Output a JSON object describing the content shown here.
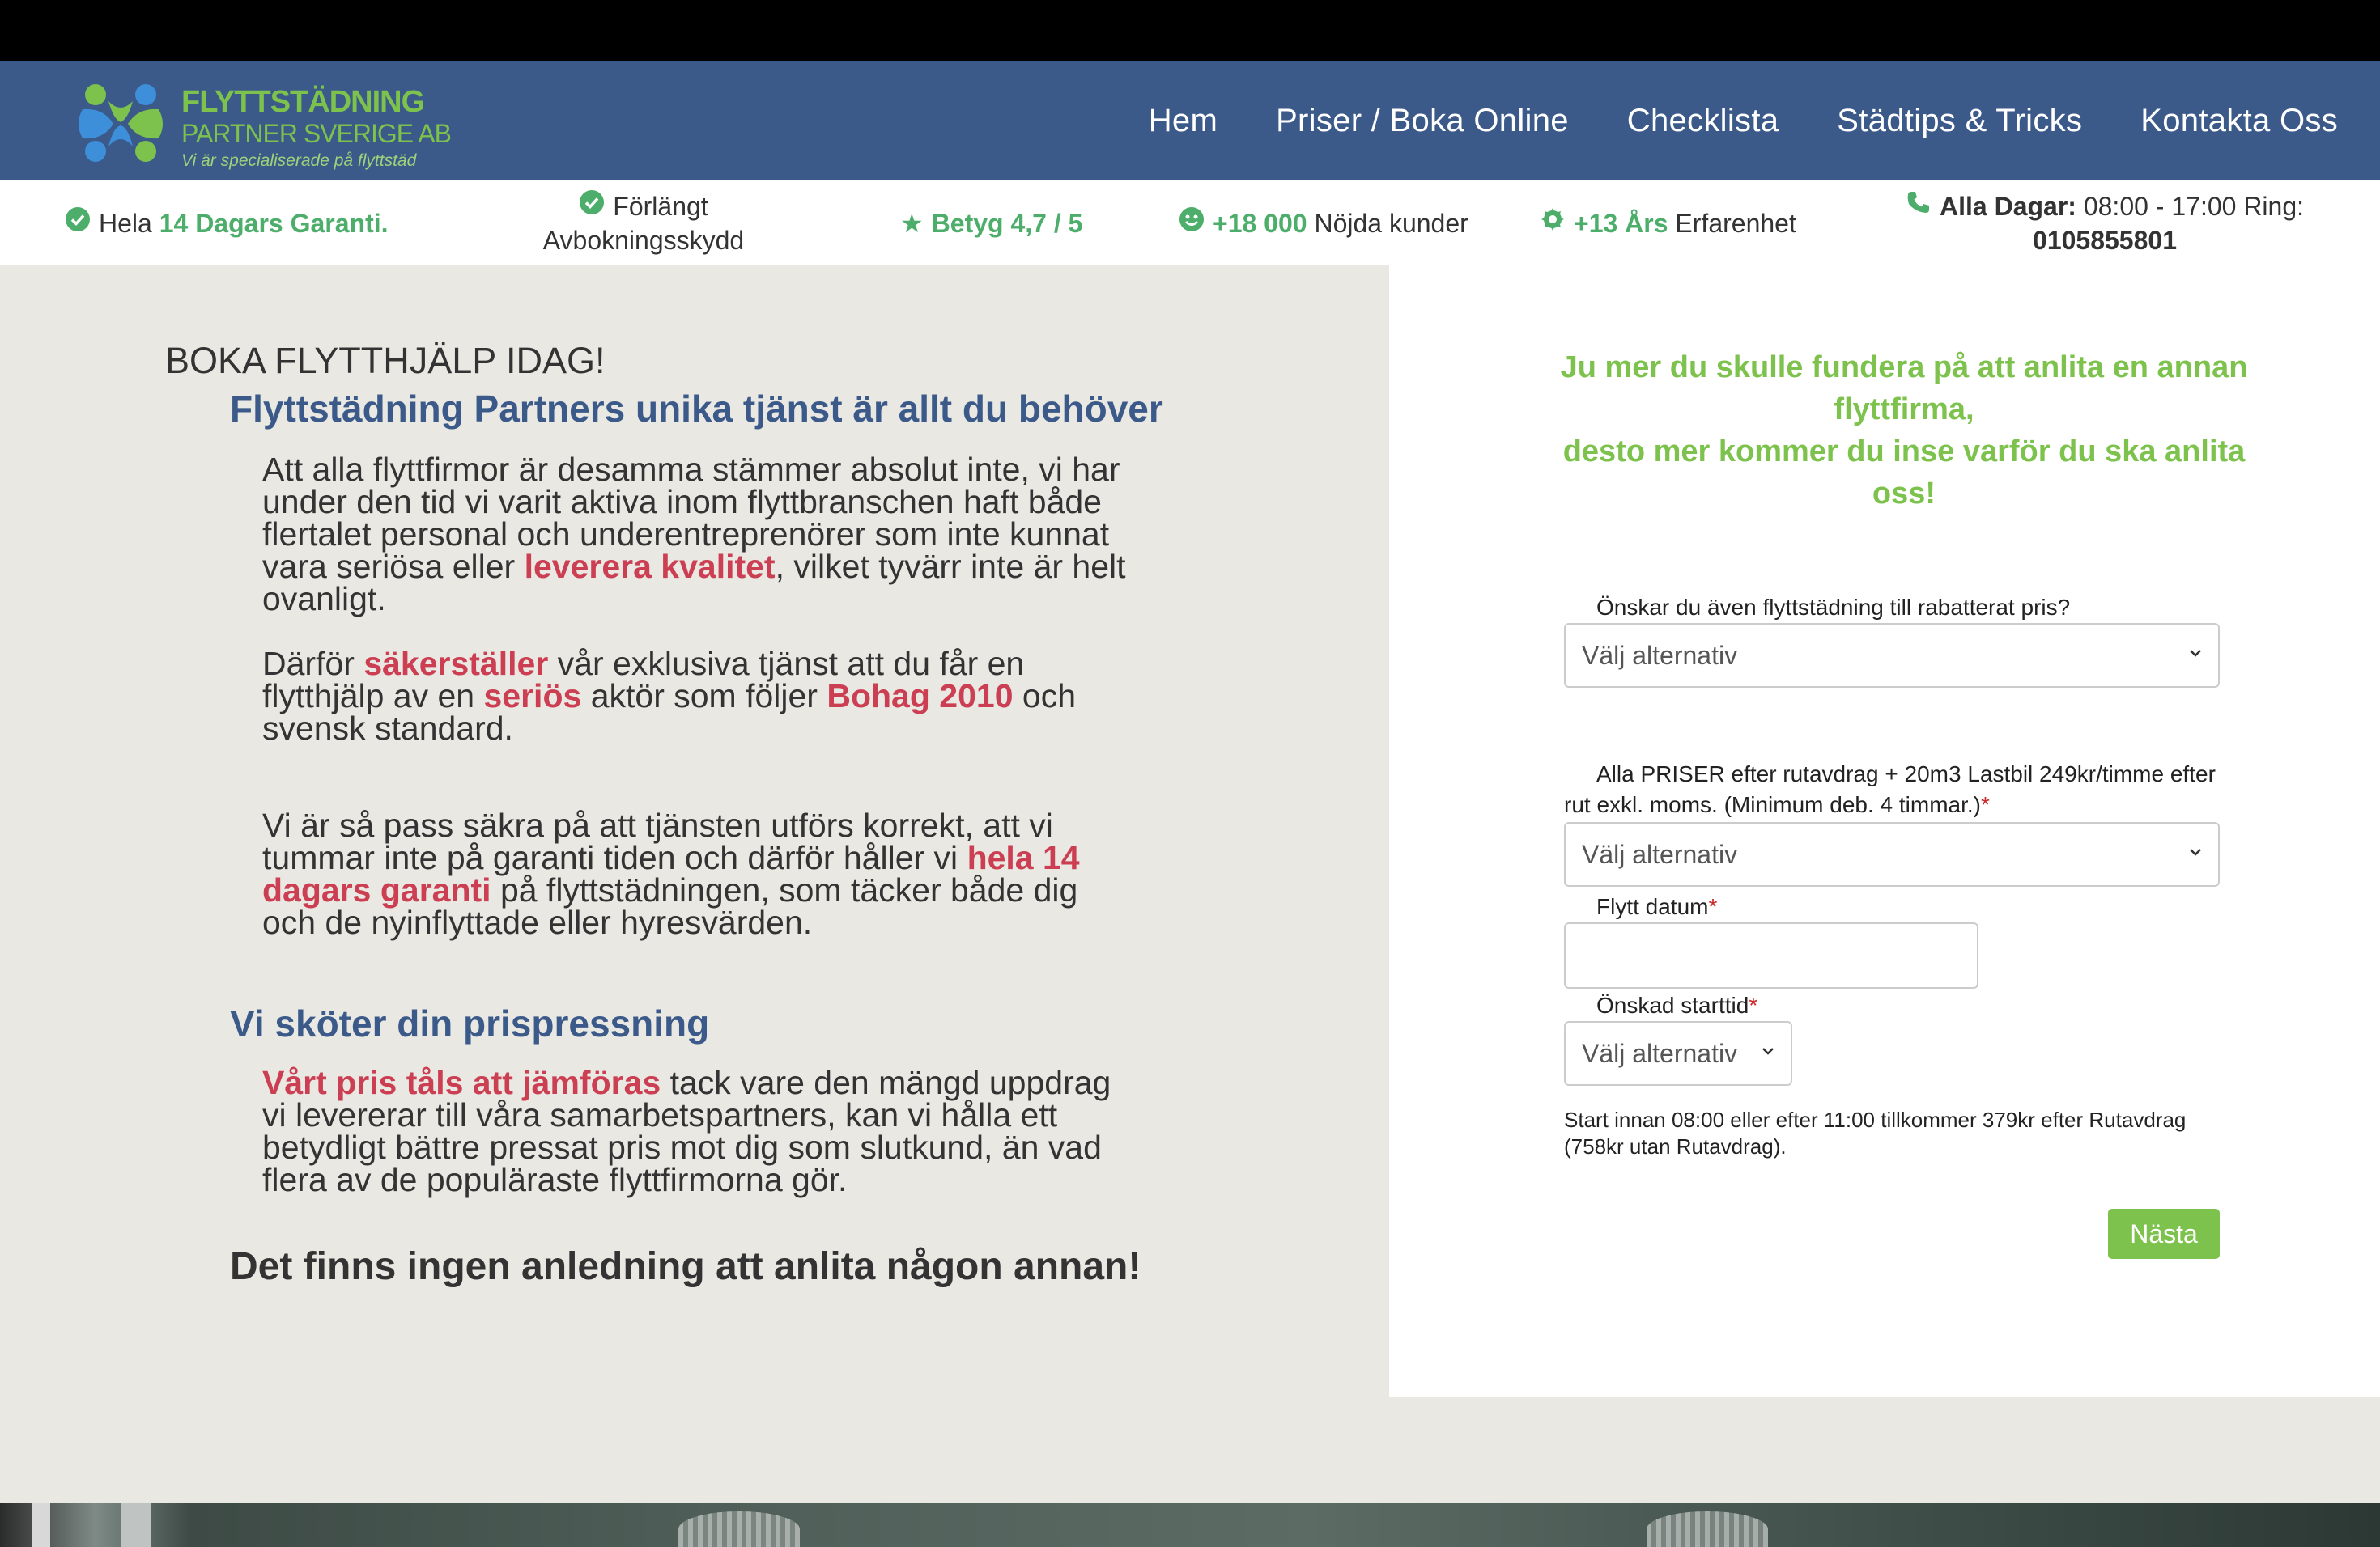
{
  "nav": {
    "logo": {
      "title": "FLYTTSTÄDNING",
      "subtitle": "PARTNER SVERIGE AB",
      "tagline": "Vi är specialiserade på flyttstäd"
    },
    "menu": [
      "Hem",
      "Priser / Boka Online",
      "Checklista",
      "Städtips & Tricks",
      "Kontakta Oss"
    ]
  },
  "usp": {
    "guarantee": {
      "icon": "check-circle-icon",
      "pre": "Hela",
      "strong": "14 Dagars Garanti."
    },
    "cancellation": {
      "icon": "check-circle-icon",
      "line1": "Förlängt",
      "line2": "Avbokningsskydd"
    },
    "rating": {
      "icon": "star-icon",
      "text": "Betyg 4,7 / 5"
    },
    "customers": {
      "icon": "smiley-icon",
      "strong": "+18 000",
      "post": "Nöjda kunder"
    },
    "experience": {
      "icon": "medal-icon",
      "strong": "+13 Års",
      "post": "Erfarenhet"
    },
    "contact": {
      "icon": "phone-icon",
      "label": "Alla Dagar:",
      "hours": "08:00 - 17:00 Ring:",
      "phone": "0105855801"
    }
  },
  "content": {
    "heading": "BOKA FLYTTHJÄLP IDAG!",
    "subheading": "Flyttstädning Partners unika tjänst är allt du behöver",
    "p1": {
      "a": "Att alla flyttfirmor är desamma stämmer absolut inte, vi har under den tid vi varit aktiva inom flyttbranschen haft både flertalet personal och underentreprenörer som inte kunnat vara seriösa eller ",
      "red": "leverera kvalitet",
      "b": ", vilket tyvärr inte är helt ovanligt."
    },
    "p2": {
      "a": "Därför ",
      "red1": "säkerställer",
      "b": " vår exklusiva tjänst att du får en flytthjälp av en ",
      "red2": "seriös",
      "c": " aktör som följer ",
      "red3": "Bohag 2010",
      "d": " och svensk standard."
    },
    "p3": {
      "a": "Vi är så pass säkra på att tjänsten utförs korrekt, att vi tummar inte på garanti tiden och därför håller vi ",
      "red": "hela 14 dagars garanti",
      "b": " på flyttstädningen, som täcker både dig och de nyinflyttade eller hyresvärden."
    },
    "heading2": "Vi sköter din prispressning",
    "p4": {
      "red": "Vårt pris tåls att jämföras",
      "a": " tack vare den mängd uppdrag vi levererar till våra samarbetspartners, kan vi hålla ett betydligt bättre pressat pris mot dig som slutkund, än vad flera av de populäraste flyttfirmorna gör."
    },
    "closing": "Det finns ingen anledning att anlita någon annan!"
  },
  "form": {
    "pitch_line1": "Ju mer du skulle fundera på att anlita en annan flyttfirma,",
    "pitch_line2": "desto mer kommer du inse varför du ska anlita oss!",
    "q1_label": "Önskar du även flyttstädning till rabatterat pris?",
    "q1_value": "Välj alternativ",
    "q2_label": "Alla PRISER efter rutavdrag + 20m3 Lastbil 249kr/timme efter rut exkl. moms. (Minimum deb. 4 timmar.)",
    "q2_value": "Välj alternativ",
    "date_label": "Flytt datum",
    "date_value": "",
    "time_label": "Önskad starttid",
    "time_value": "Välj alternativ",
    "required_mark": "*",
    "note": "Start innan 08:00 eller efter 11:00 tillkommer 379kr efter Rutavdrag (758kr utan Rutavdrag).",
    "next_button": "Nästa"
  }
}
